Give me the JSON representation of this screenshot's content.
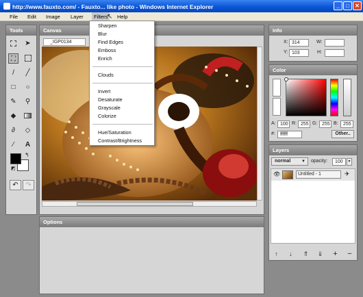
{
  "window": {
    "title": "http://www.fauxto.com/ - Fauxto... like photo - Windows Internet Explorer"
  },
  "menubar": {
    "file": "File",
    "edit": "Edit",
    "image": "Image",
    "layer": "Layer",
    "filters": "Filters",
    "help": "Help"
  },
  "filters_menu": {
    "group1": [
      "Sharpen",
      "Blur",
      "Find Edges",
      "Emboss",
      "Enrich"
    ],
    "group2": [
      "Clouds"
    ],
    "group3": [
      "Invert",
      "Desaturate",
      "Grayscale",
      "Colorize"
    ],
    "group4": [
      "Hue/Saturation",
      "Contrast/Brightness"
    ]
  },
  "tools": {
    "title": "Tools"
  },
  "canvas": {
    "title": "Canvas",
    "tab": "_IGP0134"
  },
  "options": {
    "title": "Options"
  },
  "info": {
    "title": "Info",
    "x_label": "X:",
    "x_value": "314",
    "y_label": "Y:",
    "y_value": "103",
    "w_label": "W:",
    "w_value": "",
    "h_label": "H:",
    "h_value": ""
  },
  "color": {
    "title": "Color",
    "a_label": "A:",
    "a_value": "100",
    "r_label": "R:",
    "r_value": "255",
    "g_label": "G:",
    "g_value": "255",
    "b_label": "B:",
    "b_value": "255",
    "hex_label": "#:",
    "hex_value": "ffffff",
    "other_label": "Other.."
  },
  "layers": {
    "title": "Layers",
    "blend_mode": "normal",
    "opacity_label": "opacity:",
    "opacity_value": "100",
    "items": [
      {
        "name": "Untitled - 1"
      }
    ]
  },
  "colors": {
    "titlebar": "#0a56d8",
    "panel_header": "#8f8f8f",
    "panel_bg": "#d6d6d6",
    "app_bg": "#8b8b8b"
  }
}
